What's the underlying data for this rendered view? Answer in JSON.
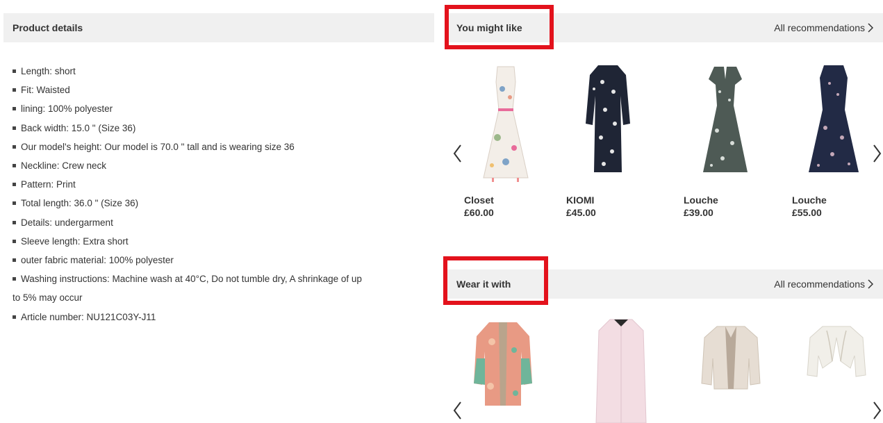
{
  "product_details": {
    "title": "Product details",
    "items": [
      "Length: short",
      "Fit: Waisted",
      "lining: 100% polyester",
      "Back width: 15.0 \" (Size 36)",
      "Our model's height: Our model is 70.0 \" tall and is wearing size 36",
      "Neckline: Crew neck",
      "Pattern: Print",
      "Total length: 36.0 \" (Size 36)",
      "Details: undergarment",
      "Sleeve length: Extra short",
      "outer fabric material: 100% polyester",
      "Washing instructions: Machine wash at 40°C, Do not tumble dry, A shrinkage of up",
      "to 5% may occur",
      "Article number: NU121C03Y-J11"
    ]
  },
  "you_might_like": {
    "title": "You might like",
    "all_link": "All recommendations",
    "products": [
      {
        "brand": "Closet",
        "price": "£60.00",
        "color": "#f3eee8"
      },
      {
        "brand": "KIOMI",
        "price": "£45.00",
        "color": "#1f2535"
      },
      {
        "brand": "Louche",
        "price": "£39.00",
        "color": "#4e5a55"
      },
      {
        "brand": "Louche",
        "price": "£55.00",
        "color": "#222a45"
      }
    ]
  },
  "wear_it_with": {
    "title": "Wear it with",
    "all_link": "All recommendations",
    "products": [
      {
        "color": "#e89a84"
      },
      {
        "color": "#f3dde3"
      },
      {
        "color": "#e6ddd3"
      },
      {
        "color": "#f1efe9"
      }
    ]
  },
  "colors": {
    "highlight": "#e3121c",
    "header_bg": "#f0f0f0"
  }
}
